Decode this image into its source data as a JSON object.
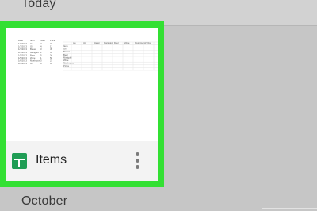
{
  "sections": {
    "today": "Today",
    "october": "October"
  },
  "file": {
    "name": "Items",
    "type_icon": "sheets-icon",
    "menu_icon": "more-vert-icon",
    "outline_color": "#33e033"
  },
  "thumbnail": {
    "left_table": {
      "headers": [
        "Date",
        "Item",
        "Sold",
        "Price"
      ],
      "rows": [
        [
          "1/3/2013",
          "Ice",
          "2",
          "34"
        ],
        [
          "1/3/2013",
          "Oil",
          "4",
          "12"
        ],
        [
          "1/3/2013",
          "Bread",
          "3",
          "45"
        ],
        [
          "1/4/2013",
          "Marigold",
          "1",
          "43"
        ],
        [
          "1/5/2013",
          "Beer",
          "5",
          "34"
        ],
        [
          "1/5/2013",
          "Wine",
          "1",
          "56"
        ],
        [
          "1/6/2013",
          "Mushroom",
          "3",
          "23"
        ],
        [
          "1/6/2013",
          "Oil",
          "6",
          "34"
        ]
      ]
    },
    "right_table": {
      "headers": [
        "Ice",
        "Oil",
        "Bread",
        "Marigold",
        "Beer",
        "Wine",
        "Mushroom",
        "Pizza"
      ],
      "row_labels": [
        "Item",
        "Oil",
        "Bread",
        "Beer",
        "Marigold",
        "Wine",
        "Mushroom",
        "Pizza"
      ]
    }
  }
}
